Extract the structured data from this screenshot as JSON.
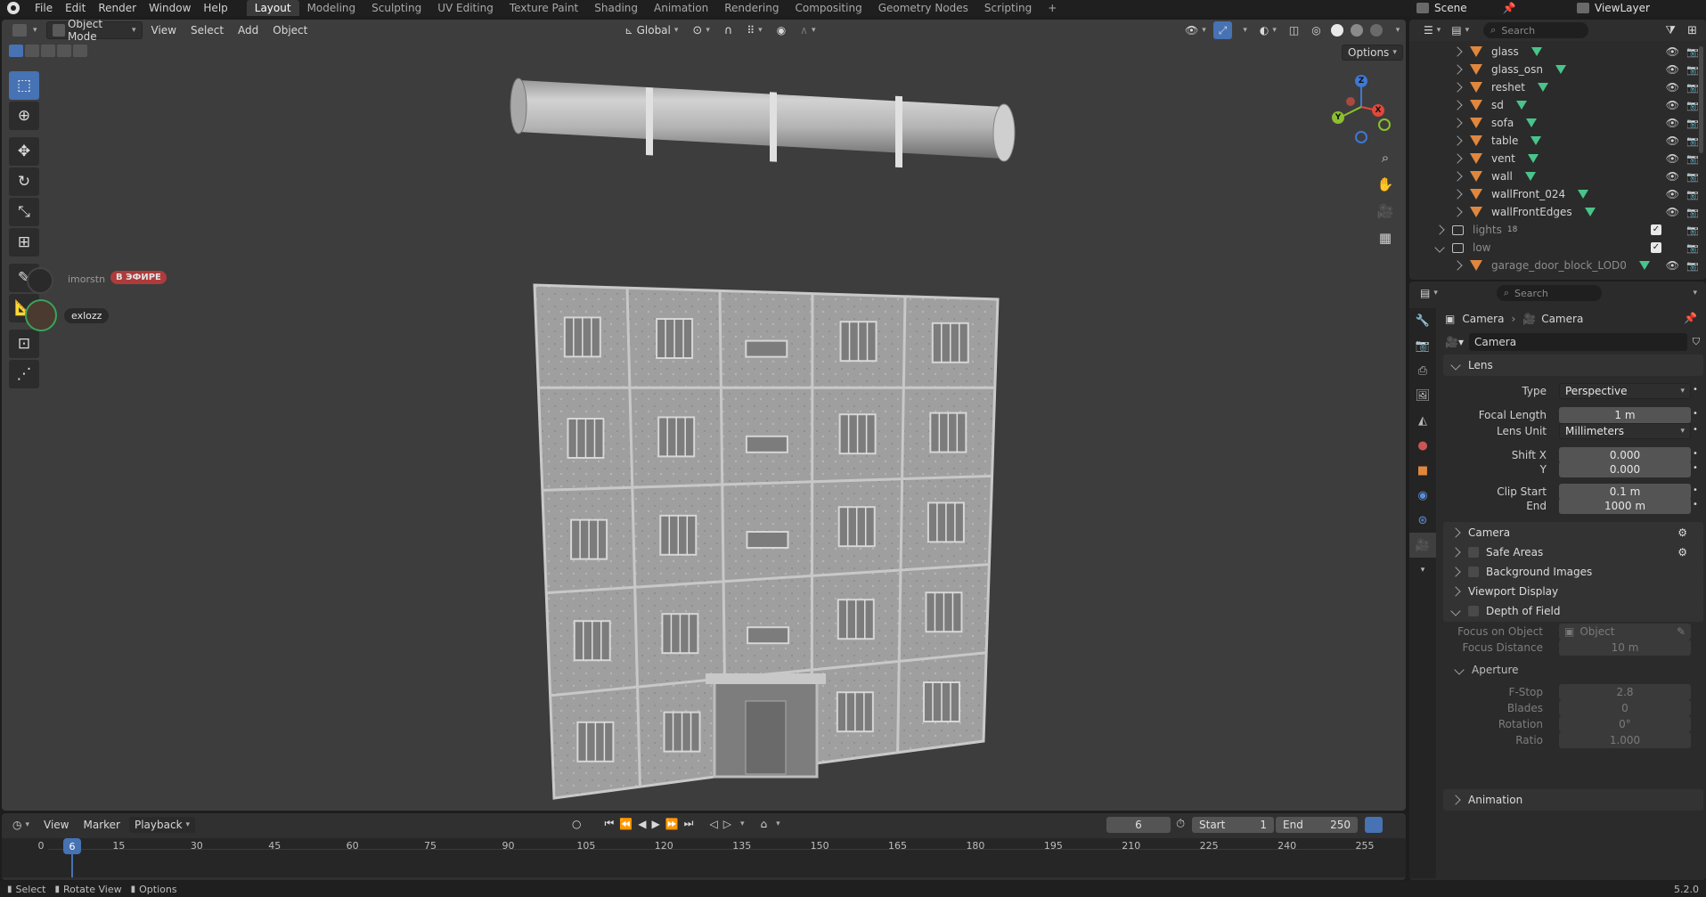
{
  "topbar": {
    "menus": [
      "File",
      "Edit",
      "Render",
      "Window",
      "Help"
    ],
    "workspaces": [
      "Layout",
      "Modeling",
      "Sculpting",
      "UV Editing",
      "Texture Paint",
      "Shading",
      "Animation",
      "Rendering",
      "Compositing",
      "Geometry Nodes",
      "Scripting"
    ],
    "add_tab": "+",
    "scene": "Scene",
    "view_layer": "ViewLayer"
  },
  "viewport": {
    "mode": "Object Mode",
    "menus": [
      "View",
      "Select",
      "Add",
      "Object"
    ],
    "orientation": "Global",
    "options": "Options",
    "gizmo": {
      "x": "X",
      "y": "Y",
      "z": "Z"
    },
    "stream_overlay": {
      "user1": "imorstn",
      "live_badge": "В ЭФИРЕ",
      "user2": "exlozz"
    }
  },
  "timeline": {
    "menus": [
      "View",
      "Marker",
      "Playback"
    ],
    "current_frame": "6",
    "start_label": "Start",
    "start": "1",
    "end_label": "End",
    "end": "250",
    "ticks": [
      "0",
      "15",
      "30",
      "45",
      "60",
      "75",
      "90",
      "105",
      "120",
      "135",
      "150",
      "165",
      "180",
      "195",
      "210",
      "225",
      "240",
      "255"
    ],
    "playhead": "6"
  },
  "statusbar": {
    "items": [
      "Select",
      "Rotate View",
      "Options"
    ],
    "version": "5.2.0"
  },
  "outliner": {
    "search_placeholder": "Search",
    "rows": [
      {
        "name": "glass",
        "type": "mesh",
        "dim": false
      },
      {
        "name": "glass_osn",
        "type": "mesh",
        "dim": false
      },
      {
        "name": "reshet",
        "type": "mesh",
        "dim": false
      },
      {
        "name": "sd",
        "type": "mesh",
        "dim": false
      },
      {
        "name": "sofa",
        "type": "mesh",
        "dim": false
      },
      {
        "name": "table",
        "type": "mesh",
        "dim": false
      },
      {
        "name": "vent",
        "type": "mesh",
        "dim": false
      },
      {
        "name": "wall",
        "type": "mesh",
        "dim": false
      },
      {
        "name": "wallFront_024",
        "type": "mesh",
        "dim": false
      },
      {
        "name": "wallFrontEdges",
        "type": "mesh",
        "dim": false
      },
      {
        "name": "lights",
        "type": "collection",
        "dim": true,
        "count": "18"
      },
      {
        "name": "low",
        "type": "collection",
        "dim": true
      },
      {
        "name": "garage_door_block_LOD0",
        "type": "mesh",
        "dim": true
      }
    ]
  },
  "properties": {
    "search_placeholder": "Search",
    "breadcrumb": [
      "Camera",
      "Camera"
    ],
    "datablock": "Camera",
    "lens": {
      "title": "Lens",
      "type_label": "Type",
      "type_value": "Perspective",
      "focal_label": "Focal Length",
      "focal_value": "1 m",
      "unit_label": "Lens Unit",
      "unit_value": "Millimeters",
      "shiftx_label": "Shift X",
      "shiftx_value": "0.000",
      "shifty_label": "Y",
      "shifty_value": "0.000",
      "clipstart_label": "Clip Start",
      "clipstart_value": "0.1 m",
      "clipend_label": "End",
      "clipend_value": "1000 m"
    },
    "panels": [
      "Camera",
      "Safe Areas",
      "Background Images",
      "Viewport Display",
      "Depth of Field"
    ],
    "dof": {
      "focus_obj_label": "Focus on Object",
      "focus_obj_placeholder": "Object",
      "focus_dist_label": "Focus Distance",
      "focus_dist_value": "10 m",
      "aperture_title": "Aperture",
      "fstop_label": "F-Stop",
      "fstop_value": "2.8",
      "blades_label": "Blades",
      "blades_value": "0",
      "rotation_label": "Rotation",
      "rotation_value": "0°",
      "ratio_label": "Ratio",
      "ratio_value": "1.000"
    },
    "animation_panel": "Animation"
  },
  "colors": {
    "accent": "#4772b3",
    "camera_tab": "#5fc2a6",
    "mesh_icon": "#e0873e",
    "modifier_icon": "#49c48a",
    "live_badge": "#c23b3b"
  }
}
